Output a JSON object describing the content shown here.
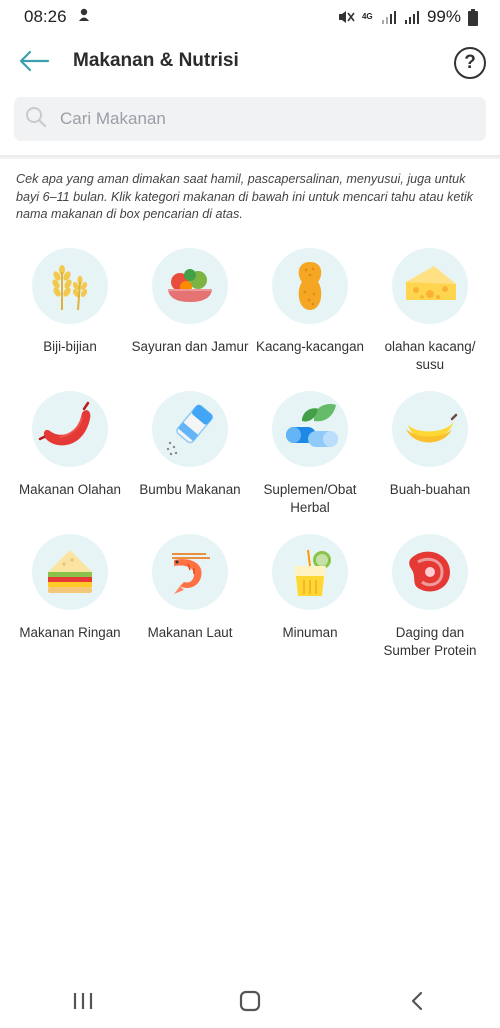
{
  "status_bar": {
    "time": "08:26",
    "network": "4G",
    "battery": "99%"
  },
  "header": {
    "title": "Makanan & Nutrisi",
    "help_label": "?"
  },
  "search": {
    "placeholder": "Cari Makanan"
  },
  "description": "Cek apa yang aman dimakan saat hamil, pascapersalinan, menyusui, juga untuk bayi 6–11 bulan. Klik kategori makanan di bawah ini untuk mencari tahu atau ketik nama makanan di box pencarian di atas.",
  "categories": [
    {
      "label": "Biji-bijian",
      "icon": "grain-icon"
    },
    {
      "label": "Sayuran dan Jamur",
      "icon": "vegetable-icon"
    },
    {
      "label": "Kacang-kacangan",
      "icon": "peanut-icon"
    },
    {
      "label": "olahan kacang/ susu",
      "icon": "cheese-icon"
    },
    {
      "label": "Makanan Olahan",
      "icon": "sausage-icon"
    },
    {
      "label": "Bumbu Makanan",
      "icon": "salt-shaker-icon"
    },
    {
      "label": "Suplemen/Obat Herbal",
      "icon": "pill-icon"
    },
    {
      "label": "Buah-buahan",
      "icon": "banana-icon"
    },
    {
      "label": "Makanan Ringan",
      "icon": "sandwich-icon"
    },
    {
      "label": "Makanan Laut",
      "icon": "shrimp-icon"
    },
    {
      "label": "Minuman",
      "icon": "drink-icon"
    },
    {
      "label": "Daging dan Sumber Protein",
      "icon": "meat-icon"
    }
  ],
  "colors": {
    "icon_bg": "#e6f4f6",
    "search_bg": "#f1f2f4",
    "accent": "#3aa0b0"
  }
}
